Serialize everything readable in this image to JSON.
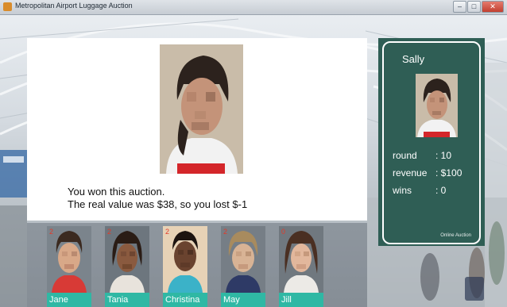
{
  "window": {
    "title": "Metropolitan Airport Luggage Auction",
    "controls": [
      "minimize",
      "maximize",
      "close"
    ]
  },
  "message": {
    "line1": "You won this auction.",
    "line2": "The real value was $38, so you lost $-1"
  },
  "player": {
    "name": "Sally",
    "stats": [
      {
        "label": "round",
        "value": ": 10"
      },
      {
        "label": "revenue",
        "value": ": $100"
      },
      {
        "label": "wins",
        "value": ": 0"
      }
    ],
    "footer": "Online Auction"
  },
  "bidders": [
    {
      "name": "Jane",
      "rank": "2"
    },
    {
      "name": "Tania",
      "rank": "2"
    },
    {
      "name": "Christina",
      "rank": "2"
    },
    {
      "name": "May",
      "rank": "2"
    },
    {
      "name": "Jill",
      "rank": "0"
    }
  ],
  "colors": {
    "card_bg": "#2f5e55",
    "name_tag": "#2fb8a4",
    "rank": "#e23b2a",
    "panel_bg": "#ffffff"
  },
  "icons": {
    "minimize": "minimize-icon",
    "maximize": "maximize-icon",
    "close": "close-icon"
  }
}
